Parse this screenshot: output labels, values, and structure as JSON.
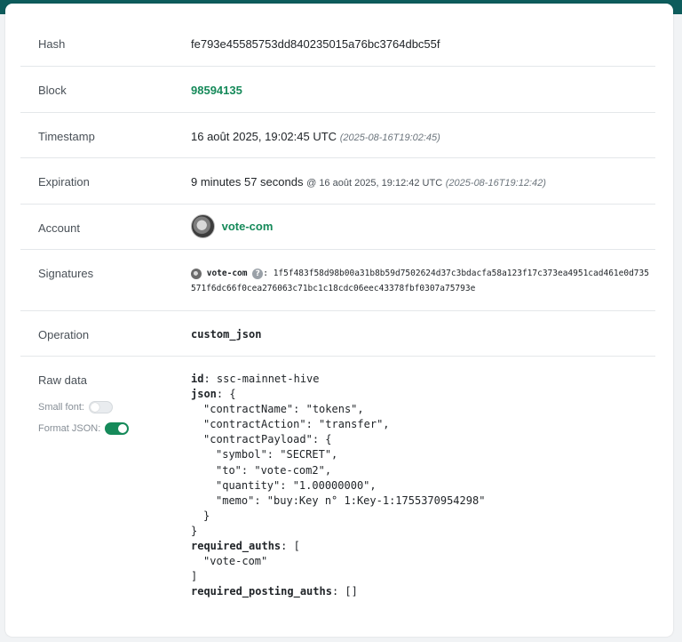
{
  "rows": {
    "hash": {
      "label": "Hash",
      "value": "fe793e45585753dd840235015a76bc3764dbc55f"
    },
    "block": {
      "label": "Block",
      "value": "98594135"
    },
    "timestamp": {
      "label": "Timestamp",
      "value": "16 août 2025, 19:02:45 UTC",
      "iso": "(2025-08-16T19:02:45)"
    },
    "expiration": {
      "label": "Expiration",
      "value": "9 minutes 57 seconds",
      "at": "@ 16 août 2025, 19:12:42 UTC",
      "iso": "(2025-08-16T19:12:42)"
    },
    "account": {
      "label": "Account",
      "value": "vote-com"
    },
    "signatures": {
      "label": "Signatures",
      "account": "vote-com",
      "colon": ":",
      "sig_line1": "1f5f483f58d98b00a31b8b59d7502624d37c3bdacfa58a123f17c373ea4951cad461e0d735",
      "sig_line2": "571f6dc66f0cea276063c71bc1c18cdc06eec43378fbf0307a75793e"
    },
    "operation": {
      "label": "Operation",
      "value": "custom_json"
    },
    "raw": {
      "label": "Raw data",
      "small_font_label": "Small font:",
      "small_font_on": false,
      "format_json_label": "Format JSON:",
      "format_json_on": true
    }
  },
  "raw_json": {
    "id_key": "id",
    "id_value": "ssc-mainnet-hive",
    "json_key": "json",
    "contract_name": "\"contractName\": \"tokens\",",
    "contract_action": "\"contractAction\": \"transfer\",",
    "contract_payload": "\"contractPayload\": {",
    "symbol": "\"symbol\": \"SECRET\",",
    "to": "\"to\": \"vote-com2\",",
    "quantity": "\"quantity\": \"1.00000000\",",
    "memo": "\"memo\": \"buy:Key n° 1:Key-1:1755370954298\"",
    "close_inner": "}",
    "close_outer": "}",
    "required_auths_key": "required_auths",
    "required_auths_open": "[",
    "required_auths_item": "\"vote-com\"",
    "required_auths_close": "]",
    "required_posting_auths_key": "required_posting_auths",
    "required_posting_auths_value": "[]"
  },
  "colors": {
    "accent": "#168a5a",
    "header": "#0d5c5c"
  }
}
